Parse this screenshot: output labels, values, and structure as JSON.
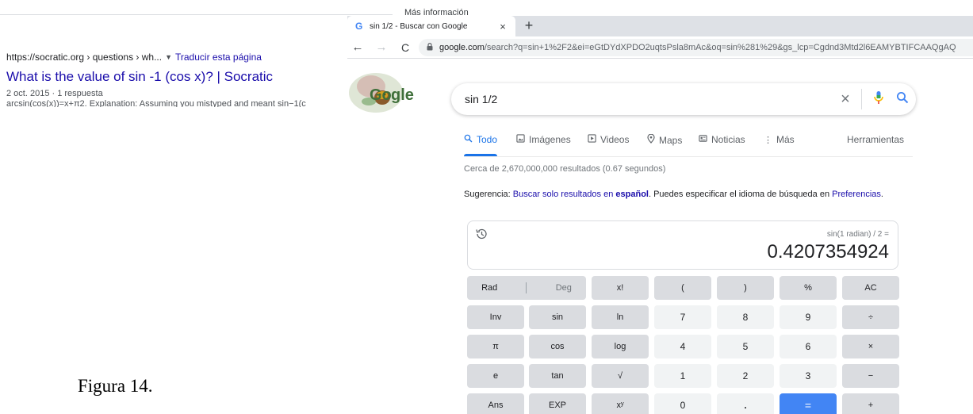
{
  "background": {
    "more_info": "Más información",
    "result": {
      "url": "https://socratic.org › questions › wh...",
      "translate": "Traducir esta página",
      "title": "What is the value of sin -1 (cos x)? | Socratic",
      "meta": "2 oct. 2015 · 1 respuesta",
      "snippet": "arcsin(cos(x))=x+π2. Explanation: Assuming you mistyped and meant sin−1(c"
    },
    "caption": "Figura 14."
  },
  "browser": {
    "tab": {
      "favicon": "G",
      "title": "sin 1/2 - Buscar con Google",
      "close": "×"
    },
    "new_tab": "+",
    "nav": {
      "back": "←",
      "forward": "→",
      "reload": "C"
    },
    "url_domain": "google.com",
    "url_rest": "/search?q=sin+1%2F2&ei=eGtDYdXPDO2uqtsPsla8mAc&oq=sin%281%29&gs_lcp=Cgdnd3Mtd2l6EAMYBTIFCAAQgAQ"
  },
  "google": {
    "logo": "Google",
    "query": "sin 1/2",
    "tabs": [
      {
        "label": "Todo",
        "icon": "search-icon"
      },
      {
        "label": "Imágenes",
        "icon": "image-icon"
      },
      {
        "label": "Videos",
        "icon": "video-icon"
      },
      {
        "label": "Maps",
        "icon": "map-pin-icon"
      },
      {
        "label": "Noticias",
        "icon": "news-icon"
      },
      {
        "label": "Más",
        "icon": "more-icon"
      },
      {
        "label": "Herramientas",
        "icon": ""
      }
    ],
    "result_stats": "Cerca de 2,670,000,000 resultados (0.67 segundos)",
    "suggestion": {
      "prefix": "Sugerencia: ",
      "link": "Buscar solo resultados en ",
      "link_bold": "español",
      "middle": ". Puedes especificar el idioma de búsqueda en ",
      "pref_link": "Preferencias",
      "end": "."
    },
    "calculator": {
      "expression": "sin(1 radian) / 2 =",
      "result": "0.4207354924",
      "keys": {
        "rad": "Rad",
        "deg": "Deg",
        "fact": "x!",
        "lparen": "(",
        "rparen": ")",
        "pct": "%",
        "ac": "AC",
        "inv": "Inv",
        "sin": "sin",
        "ln": "ln",
        "k7": "7",
        "k8": "8",
        "k9": "9",
        "div": "÷",
        "pi": "π",
        "cos": "cos",
        "log": "log",
        "k4": "4",
        "k5": "5",
        "k6": "6",
        "mul": "×",
        "e": "e",
        "tan": "tan",
        "sqrt": "√",
        "k1": "1",
        "k2": "2",
        "k3": "3",
        "minus": "−",
        "ans": "Ans",
        "exp": "EXP",
        "pow": "xʸ",
        "k0": "0",
        "dot": ".",
        "eq": "=",
        "plus": "+"
      }
    }
  },
  "colors": {
    "accent": "#1a73e8",
    "link": "#1a0dab",
    "equals": "#4285f4"
  }
}
